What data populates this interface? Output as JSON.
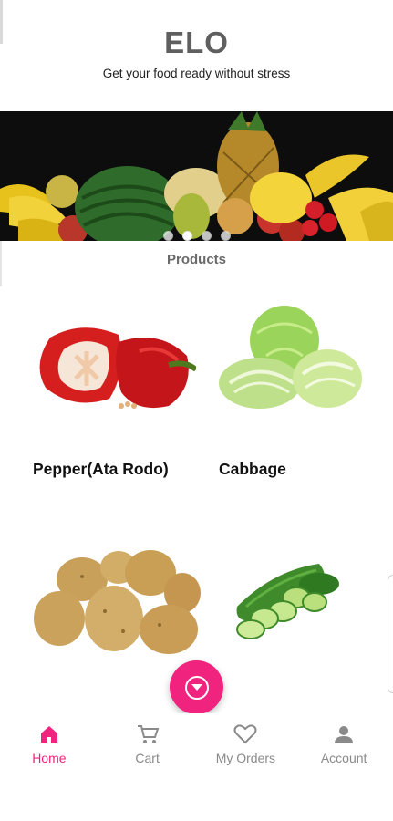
{
  "app": {
    "title": "ELO",
    "tagline": "Get your food ready without stress"
  },
  "banner": {
    "slides": 4,
    "active_slide": 1
  },
  "products_section": {
    "title": "Products",
    "items": [
      {
        "name": "Pepper(Ata Rodo)",
        "image": "red-bell-pepper"
      },
      {
        "name": "Cabbage",
        "image": "cabbage"
      },
      {
        "name": "",
        "image": "potatoes"
      },
      {
        "name": "",
        "image": "cucumber"
      }
    ]
  },
  "fab": {
    "icon": "chevron-down-circle-icon"
  },
  "bottom_nav": {
    "items": [
      {
        "label": "Home",
        "icon": "home-icon",
        "active": true
      },
      {
        "label": "Cart",
        "icon": "cart-icon",
        "active": false
      },
      {
        "label": "My Orders",
        "icon": "heart-icon",
        "active": false
      },
      {
        "label": "Account",
        "icon": "person-icon",
        "active": false
      }
    ]
  },
  "colors": {
    "accent": "#f0237e",
    "title_gray": "#5f5f5f",
    "nav_inactive": "#8a8a8a"
  }
}
